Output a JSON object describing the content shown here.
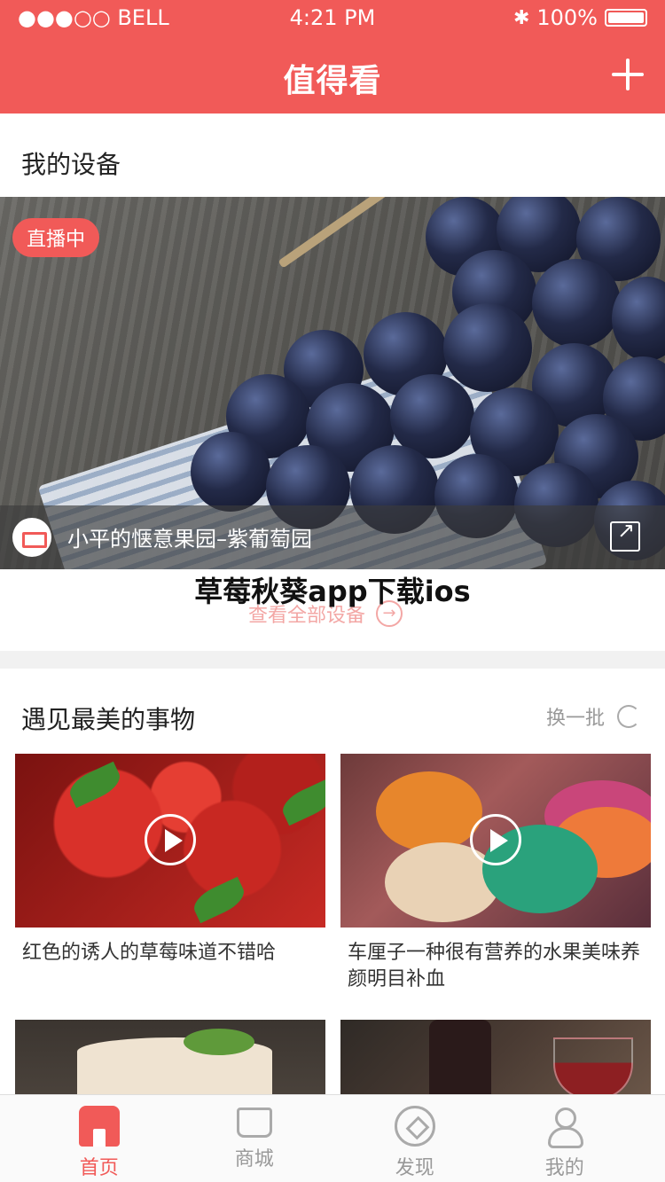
{
  "status_bar": {
    "carrier": "●●●○○ BELL",
    "time": "4:21 PM",
    "bluetooth": "✱",
    "battery": "100%"
  },
  "header": {
    "title": "值得看",
    "add_icon": "plus-icon"
  },
  "my_devices": {
    "title": "我的设备",
    "live_badge": "直播中",
    "caption": "小平的惬意果园–紫葡萄园",
    "see_all": "查看全部设备",
    "see_all_arrow": "→"
  },
  "overlay_title": "草莓秋葵app下载ios",
  "discover": {
    "title": "遇见最美的事物",
    "refresh": "换一批",
    "cards": [
      {
        "text": "红色的诱人的草莓味道不错哈"
      },
      {
        "text": "车厘子一种很有营养的水果美味养颜明目补血"
      }
    ]
  },
  "tabbar": {
    "items": [
      {
        "label": "首页",
        "icon": "shop-icon",
        "active": true
      },
      {
        "label": "商城",
        "icon": "cart-icon",
        "active": false
      },
      {
        "label": "发现",
        "icon": "compass-icon",
        "active": false
      },
      {
        "label": "我的",
        "icon": "person-icon",
        "active": false
      }
    ]
  },
  "colors": {
    "accent": "#f15a58",
    "muted": "#999999"
  }
}
